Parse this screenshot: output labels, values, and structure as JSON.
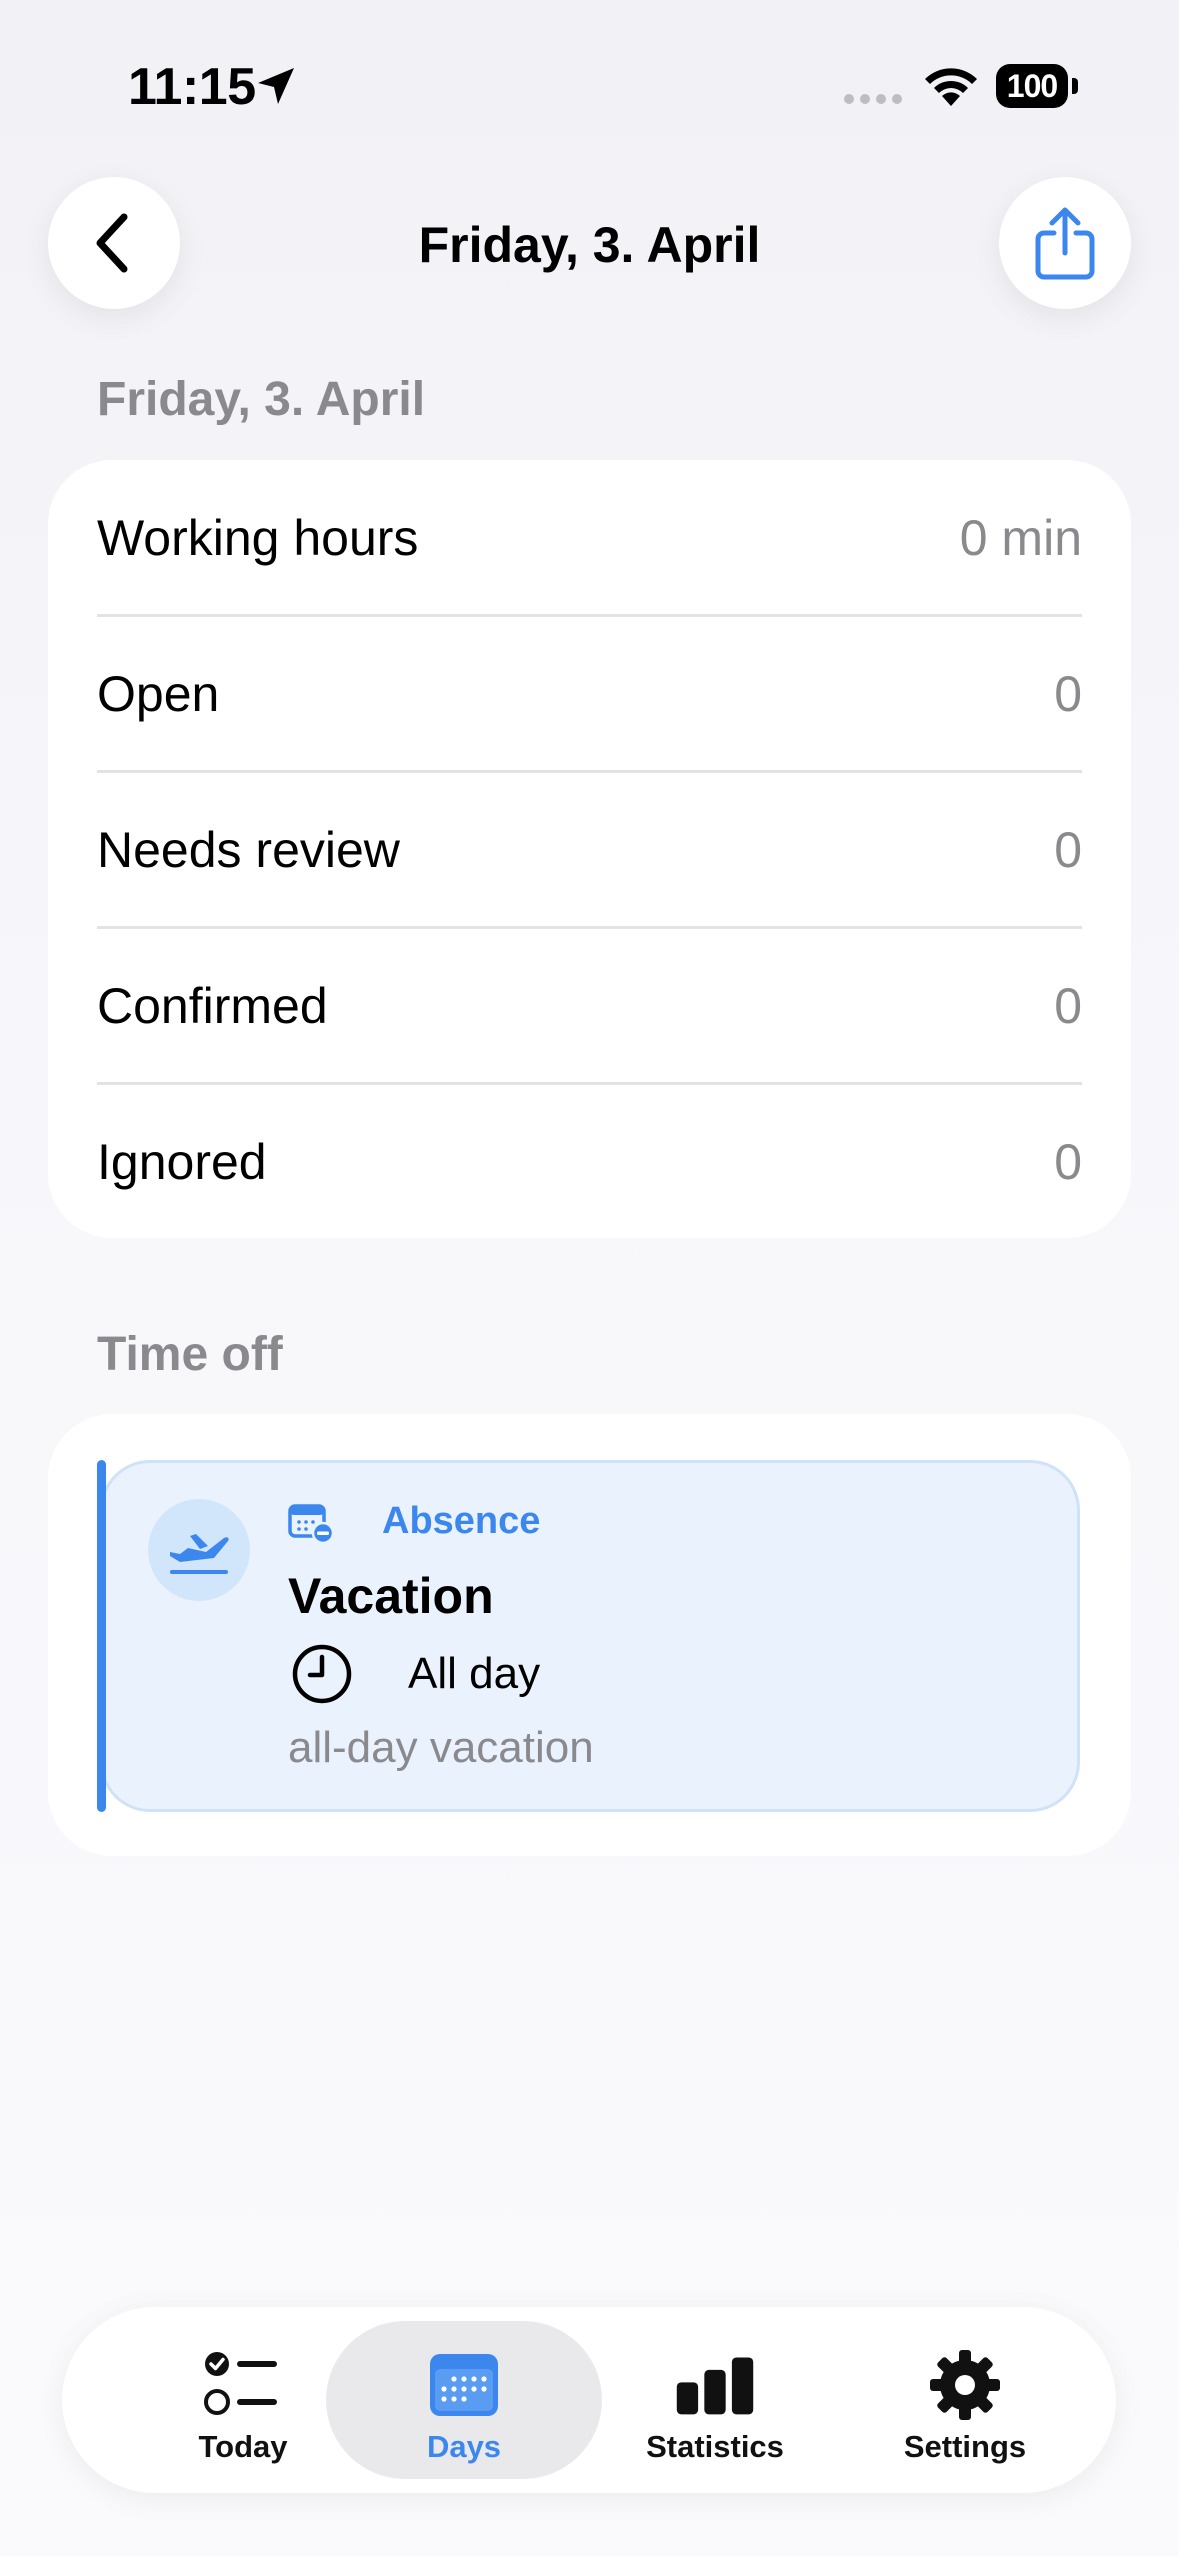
{
  "status_bar": {
    "time": "11:15",
    "battery": "100"
  },
  "header": {
    "title": "Friday, 3. April"
  },
  "summary": {
    "section_label": "Friday, 3. April",
    "rows": [
      {
        "label": "Working hours",
        "value": "0 min"
      },
      {
        "label": "Open",
        "value": "0"
      },
      {
        "label": "Needs review",
        "value": "0"
      },
      {
        "label": "Confirmed",
        "value": "0"
      },
      {
        "label": "Ignored",
        "value": "0"
      }
    ]
  },
  "time_off": {
    "section_label": "Time off",
    "entry": {
      "type": "Absence",
      "title": "Vacation",
      "time": "All day",
      "note": "all-day vacation"
    }
  },
  "tabs": [
    {
      "label": "Today",
      "icon": "checklist-icon"
    },
    {
      "label": "Days",
      "icon": "calendar-icon",
      "active": true
    },
    {
      "label": "Statistics",
      "icon": "bar-chart-icon"
    },
    {
      "label": "Settings",
      "icon": "gear-icon"
    }
  ],
  "colors": {
    "accent": "#3b87ee",
    "secondary_text": "#8a8a8e",
    "absence_bg": "#eaf3fd"
  }
}
